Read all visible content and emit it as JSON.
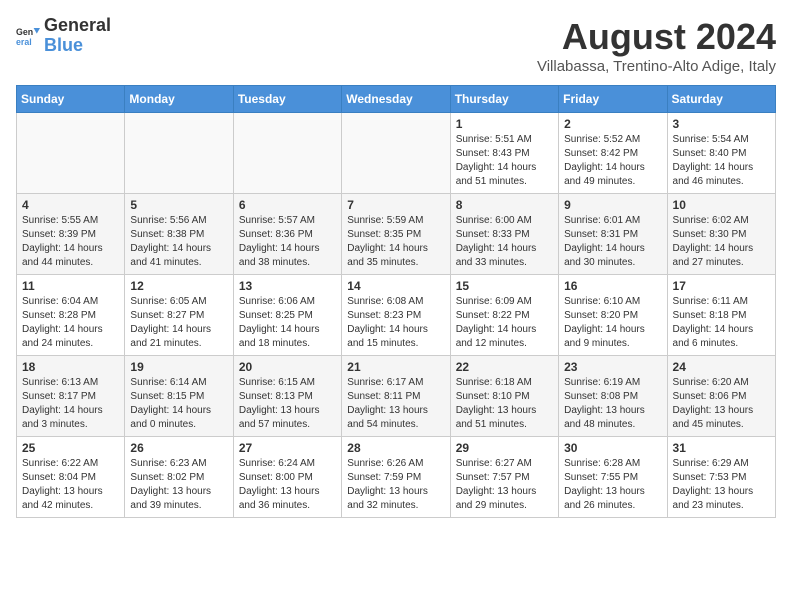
{
  "logo": {
    "text_general": "General",
    "text_blue": "Blue"
  },
  "title": "August 2024",
  "location": "Villabassa, Trentino-Alto Adige, Italy",
  "days_of_week": [
    "Sunday",
    "Monday",
    "Tuesday",
    "Wednesday",
    "Thursday",
    "Friday",
    "Saturday"
  ],
  "weeks": [
    [
      {
        "day": "",
        "content": ""
      },
      {
        "day": "",
        "content": ""
      },
      {
        "day": "",
        "content": ""
      },
      {
        "day": "",
        "content": ""
      },
      {
        "day": "1",
        "content": "Sunrise: 5:51 AM\nSunset: 8:43 PM\nDaylight: 14 hours and 51 minutes."
      },
      {
        "day": "2",
        "content": "Sunrise: 5:52 AM\nSunset: 8:42 PM\nDaylight: 14 hours and 49 minutes."
      },
      {
        "day": "3",
        "content": "Sunrise: 5:54 AM\nSunset: 8:40 PM\nDaylight: 14 hours and 46 minutes."
      }
    ],
    [
      {
        "day": "4",
        "content": "Sunrise: 5:55 AM\nSunset: 8:39 PM\nDaylight: 14 hours and 44 minutes."
      },
      {
        "day": "5",
        "content": "Sunrise: 5:56 AM\nSunset: 8:38 PM\nDaylight: 14 hours and 41 minutes."
      },
      {
        "day": "6",
        "content": "Sunrise: 5:57 AM\nSunset: 8:36 PM\nDaylight: 14 hours and 38 minutes."
      },
      {
        "day": "7",
        "content": "Sunrise: 5:59 AM\nSunset: 8:35 PM\nDaylight: 14 hours and 35 minutes."
      },
      {
        "day": "8",
        "content": "Sunrise: 6:00 AM\nSunset: 8:33 PM\nDaylight: 14 hours and 33 minutes."
      },
      {
        "day": "9",
        "content": "Sunrise: 6:01 AM\nSunset: 8:31 PM\nDaylight: 14 hours and 30 minutes."
      },
      {
        "day": "10",
        "content": "Sunrise: 6:02 AM\nSunset: 8:30 PM\nDaylight: 14 hours and 27 minutes."
      }
    ],
    [
      {
        "day": "11",
        "content": "Sunrise: 6:04 AM\nSunset: 8:28 PM\nDaylight: 14 hours and 24 minutes."
      },
      {
        "day": "12",
        "content": "Sunrise: 6:05 AM\nSunset: 8:27 PM\nDaylight: 14 hours and 21 minutes."
      },
      {
        "day": "13",
        "content": "Sunrise: 6:06 AM\nSunset: 8:25 PM\nDaylight: 14 hours and 18 minutes."
      },
      {
        "day": "14",
        "content": "Sunrise: 6:08 AM\nSunset: 8:23 PM\nDaylight: 14 hours and 15 minutes."
      },
      {
        "day": "15",
        "content": "Sunrise: 6:09 AM\nSunset: 8:22 PM\nDaylight: 14 hours and 12 minutes."
      },
      {
        "day": "16",
        "content": "Sunrise: 6:10 AM\nSunset: 8:20 PM\nDaylight: 14 hours and 9 minutes."
      },
      {
        "day": "17",
        "content": "Sunrise: 6:11 AM\nSunset: 8:18 PM\nDaylight: 14 hours and 6 minutes."
      }
    ],
    [
      {
        "day": "18",
        "content": "Sunrise: 6:13 AM\nSunset: 8:17 PM\nDaylight: 14 hours and 3 minutes."
      },
      {
        "day": "19",
        "content": "Sunrise: 6:14 AM\nSunset: 8:15 PM\nDaylight: 14 hours and 0 minutes."
      },
      {
        "day": "20",
        "content": "Sunrise: 6:15 AM\nSunset: 8:13 PM\nDaylight: 13 hours and 57 minutes."
      },
      {
        "day": "21",
        "content": "Sunrise: 6:17 AM\nSunset: 8:11 PM\nDaylight: 13 hours and 54 minutes."
      },
      {
        "day": "22",
        "content": "Sunrise: 6:18 AM\nSunset: 8:10 PM\nDaylight: 13 hours and 51 minutes."
      },
      {
        "day": "23",
        "content": "Sunrise: 6:19 AM\nSunset: 8:08 PM\nDaylight: 13 hours and 48 minutes."
      },
      {
        "day": "24",
        "content": "Sunrise: 6:20 AM\nSunset: 8:06 PM\nDaylight: 13 hours and 45 minutes."
      }
    ],
    [
      {
        "day": "25",
        "content": "Sunrise: 6:22 AM\nSunset: 8:04 PM\nDaylight: 13 hours and 42 minutes."
      },
      {
        "day": "26",
        "content": "Sunrise: 6:23 AM\nSunset: 8:02 PM\nDaylight: 13 hours and 39 minutes."
      },
      {
        "day": "27",
        "content": "Sunrise: 6:24 AM\nSunset: 8:00 PM\nDaylight: 13 hours and 36 minutes."
      },
      {
        "day": "28",
        "content": "Sunrise: 6:26 AM\nSunset: 7:59 PM\nDaylight: 13 hours and 32 minutes."
      },
      {
        "day": "29",
        "content": "Sunrise: 6:27 AM\nSunset: 7:57 PM\nDaylight: 13 hours and 29 minutes."
      },
      {
        "day": "30",
        "content": "Sunrise: 6:28 AM\nSunset: 7:55 PM\nDaylight: 13 hours and 26 minutes."
      },
      {
        "day": "31",
        "content": "Sunrise: 6:29 AM\nSunset: 7:53 PM\nDaylight: 13 hours and 23 minutes."
      }
    ]
  ]
}
